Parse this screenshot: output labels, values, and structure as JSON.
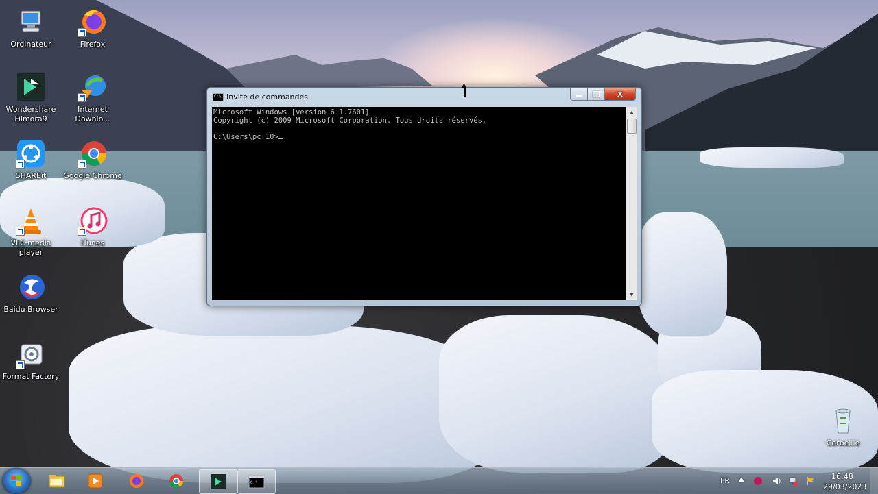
{
  "desktop": {
    "icons": [
      {
        "label": "Ordinateur"
      },
      {
        "label": "Firefox"
      },
      {
        "label": "Wondershare Filmora9"
      },
      {
        "label": "Internet Downlo..."
      },
      {
        "label": "SHAREit"
      },
      {
        "label": "Google Chrome"
      },
      {
        "label": "VLC media player"
      },
      {
        "label": "iTunes"
      },
      {
        "label": "Baidu Browser"
      },
      {
        "label": "Format Factory"
      },
      {
        "label": "Corbeille"
      }
    ]
  },
  "cmd_window": {
    "title": "Invite de commandes",
    "close_label": "x",
    "lines": [
      "Microsoft Windows [version 6.1.7601]",
      "Copyright (c) 2009 Microsoft Corporation. Tous droits réservés.",
      "",
      "C:\\Users\\pc 10>"
    ]
  },
  "taskbar": {
    "pinned": [
      "Windows Explorer",
      "Windows Media Player",
      "Firefox",
      "Google Chrome",
      "Wondershare Filmora9",
      "Invite de commandes"
    ],
    "language": "FR",
    "time": "16:48",
    "date": "29/03/2023"
  },
  "colors": {
    "console_bg": "#000000",
    "console_text": "#c0c0c0",
    "close_red": "#c8351c"
  }
}
